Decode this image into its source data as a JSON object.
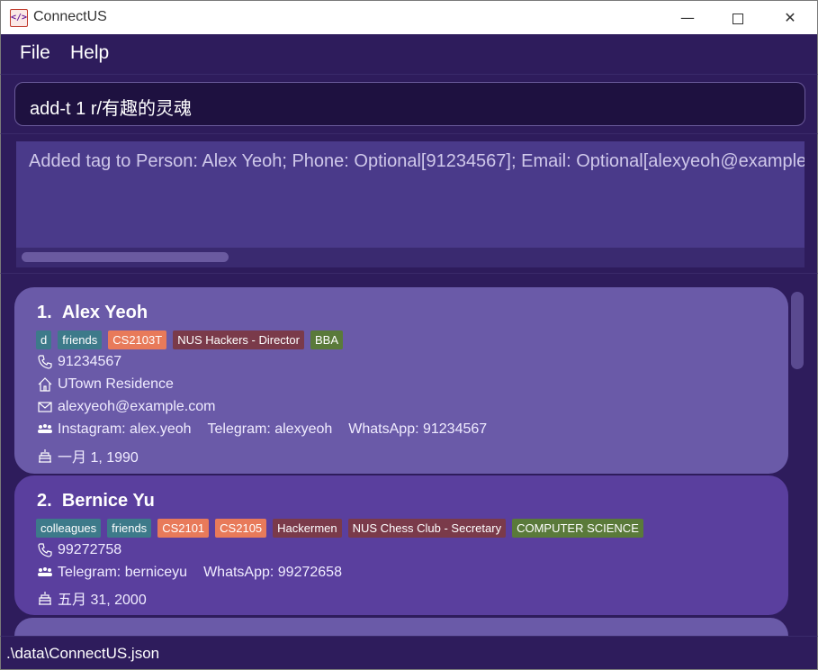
{
  "window": {
    "title": "ConnectUS",
    "minimize": "—",
    "close": "✕"
  },
  "menu": {
    "file": "File",
    "help": "Help"
  },
  "command": {
    "value": "add-t 1 r/有趣的灵魂"
  },
  "result": {
    "text": "Added tag to Person: Alex Yeoh; Phone: Optional[91234567]; Email: Optional[alexyeoh@example.com]"
  },
  "persons": [
    {
      "index": "1.",
      "name": "Alex Yeoh",
      "tags": [
        {
          "label": "d",
          "color": "#3d7a8a"
        },
        {
          "label": "friends",
          "color": "#3d7a8a"
        },
        {
          "label": "CS2103T",
          "color": "#e87a5a"
        },
        {
          "label": "NUS Hackers - Director",
          "color": "#7a3a4a"
        },
        {
          "label": "BBA",
          "color": "#5a7a3a"
        }
      ],
      "phone": "91234567",
      "address": "UTown Residence",
      "email": "alexyeoh@example.com",
      "socials": [
        "Instagram: alex.yeoh",
        "Telegram: alexyeoh",
        "WhatsApp: 91234567"
      ],
      "birthday": "一月 1, 1990"
    },
    {
      "index": "2.",
      "name": "Bernice Yu",
      "tags": [
        {
          "label": "colleagues",
          "color": "#3d7a8a"
        },
        {
          "label": "friends",
          "color": "#3d7a8a"
        },
        {
          "label": "CS2101",
          "color": "#e87a5a"
        },
        {
          "label": "CS2105",
          "color": "#e87a5a"
        },
        {
          "label": "Hackermen",
          "color": "#7a3a4a"
        },
        {
          "label": "NUS Chess Club - Secretary",
          "color": "#7a3a4a"
        },
        {
          "label": "COMPUTER SCIENCE",
          "color": "#5a7a3a"
        }
      ],
      "phone": "99272758",
      "socials": [
        "Telegram: berniceyu",
        "WhatsApp: 99272658"
      ],
      "birthday": "五月 31, 2000"
    }
  ],
  "status": {
    "path": ".\\data\\ConnectUS.json"
  }
}
